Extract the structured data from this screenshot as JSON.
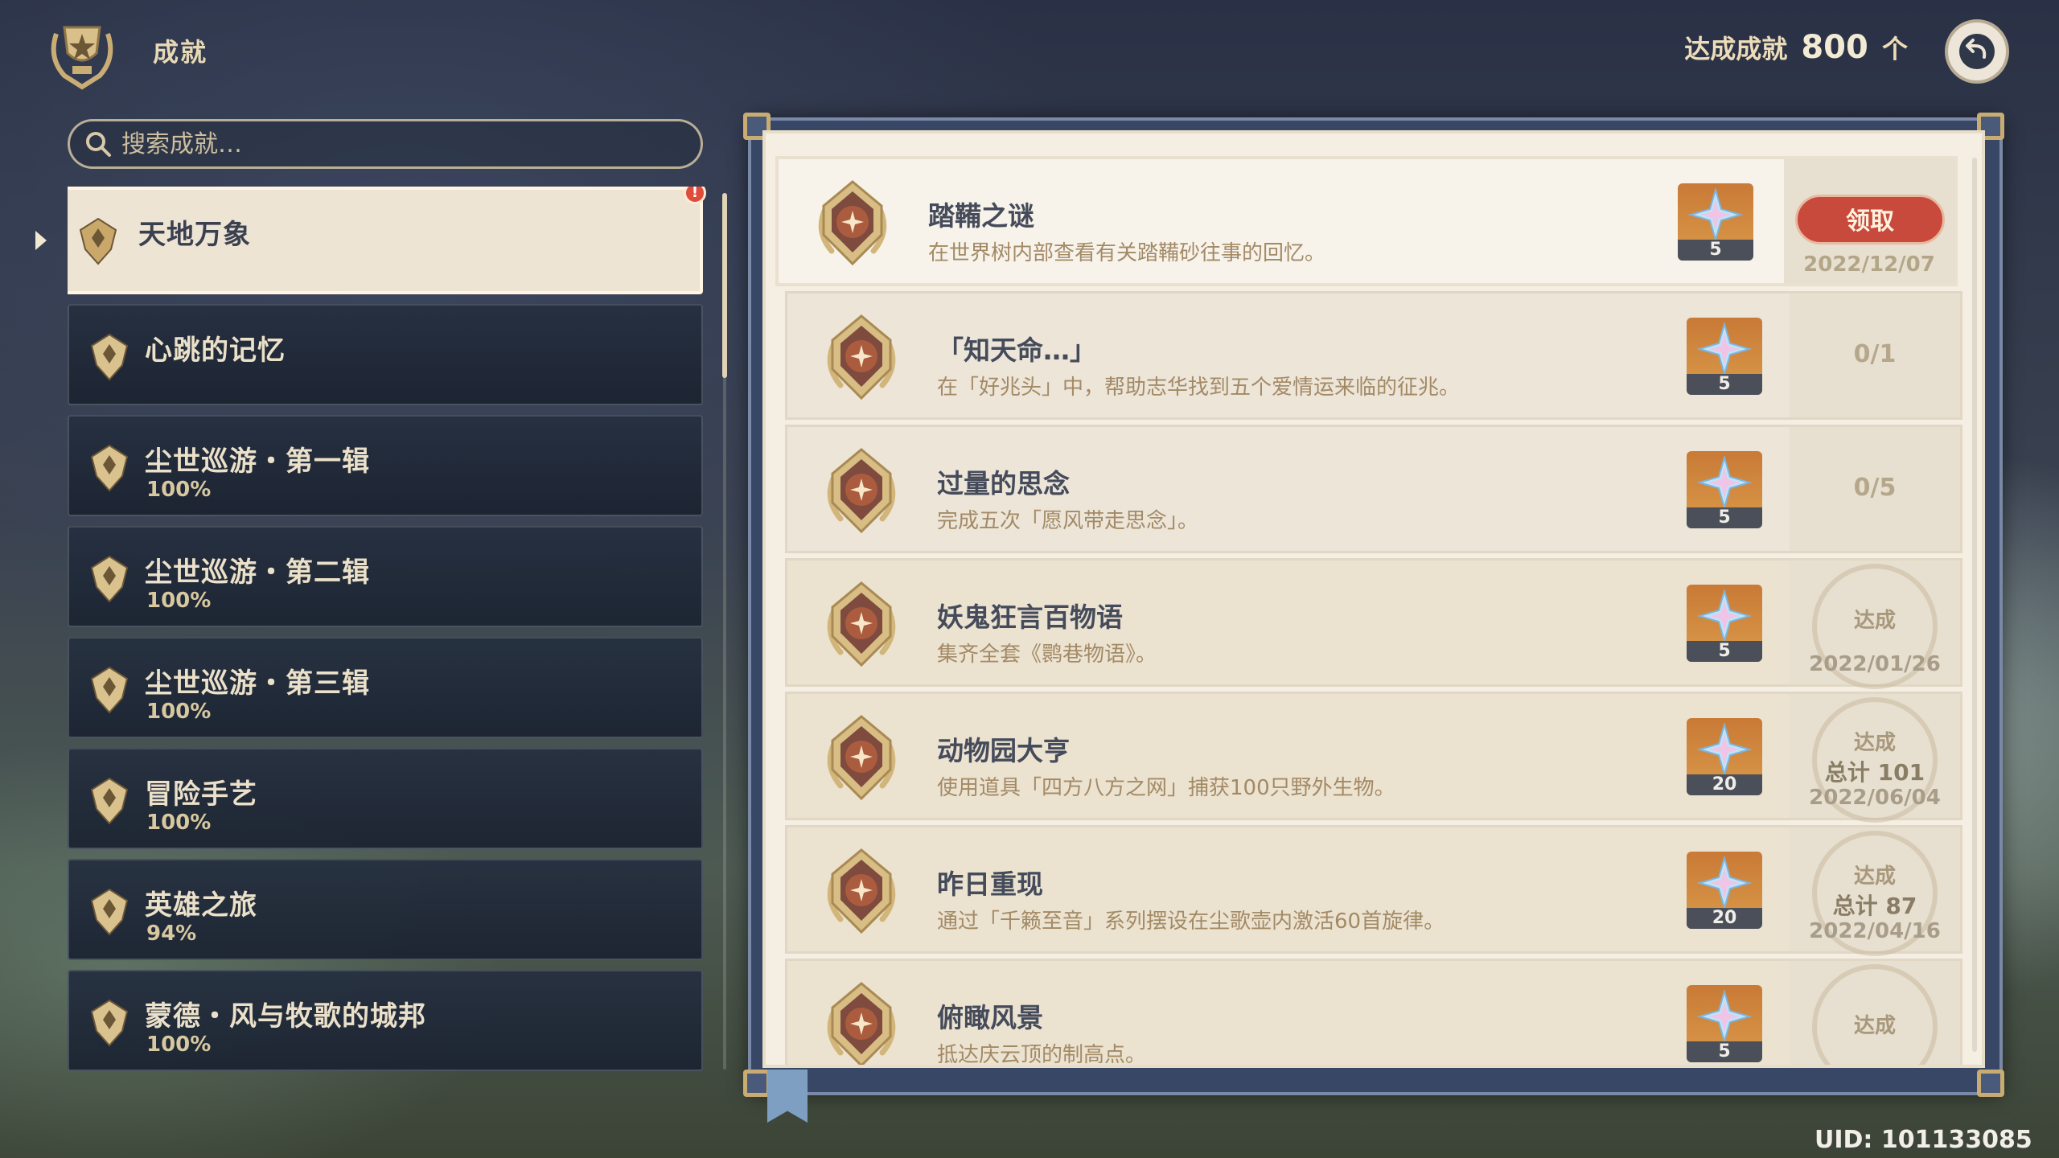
{
  "header": {
    "title": "成就",
    "summary_prefix": "达成成就",
    "summary_count": "800",
    "summary_suffix": "个"
  },
  "search": {
    "placeholder": "搜索成就…"
  },
  "categories": [
    {
      "name": "天地万象",
      "percent": "",
      "active": true,
      "badge": "!"
    },
    {
      "name": "心跳的记忆",
      "percent": ""
    },
    {
      "name": "尘世巡游・第一辑",
      "percent": "100%"
    },
    {
      "name": "尘世巡游・第二辑",
      "percent": "100%"
    },
    {
      "name": "尘世巡游・第三辑",
      "percent": "100%"
    },
    {
      "name": "冒险手艺",
      "percent": "100%"
    },
    {
      "name": "英雄之旅",
      "percent": "94%"
    },
    {
      "name": "蒙德・风与牧歌的城邦",
      "percent": "100%"
    }
  ],
  "achievements": [
    {
      "name": "踏鞴之谜",
      "desc": "在世界树内部查看有关踏鞴砂往事的回忆。",
      "reward": "5",
      "claim_label": "领取",
      "date": "2022/12/07"
    },
    {
      "name": "「知天命…」",
      "desc": "在「好兆头」中，帮助志华找到五个爱情运来临的征兆。",
      "reward": "5",
      "progress": "0/1"
    },
    {
      "name": "过量的思念",
      "desc": "完成五次「愿风带走思念」。",
      "reward": "5",
      "progress": "0/5"
    },
    {
      "name": "妖鬼狂言百物语",
      "desc": "集齐全套《鹮巷物语》。",
      "reward": "5",
      "status": "达成",
      "date": "2022/01/26"
    },
    {
      "name": "动物园大亨",
      "desc": "使用道具「四方八方之网」捕获100只野外生物。",
      "reward": "20",
      "status": "达成",
      "total": "总计 101",
      "date": "2022/06/04"
    },
    {
      "name": "昨日重现",
      "desc": "通过「千籁至音」系列摆设在尘歌壶内激活60首旋律。",
      "reward": "20",
      "status": "达成",
      "total": "总计 87",
      "date": "2022/04/16"
    },
    {
      "name": "俯瞰风景",
      "desc": "抵达庆云顶的制高点。",
      "reward": "5",
      "status": "达成"
    }
  ],
  "footer": {
    "uid": "UID: 101133085"
  },
  "colors": {
    "claim": "#c84a3c",
    "panel_bg": "#f4eee3",
    "sidebar_item": "#263040",
    "accent_gold": "#c9ac72"
  }
}
